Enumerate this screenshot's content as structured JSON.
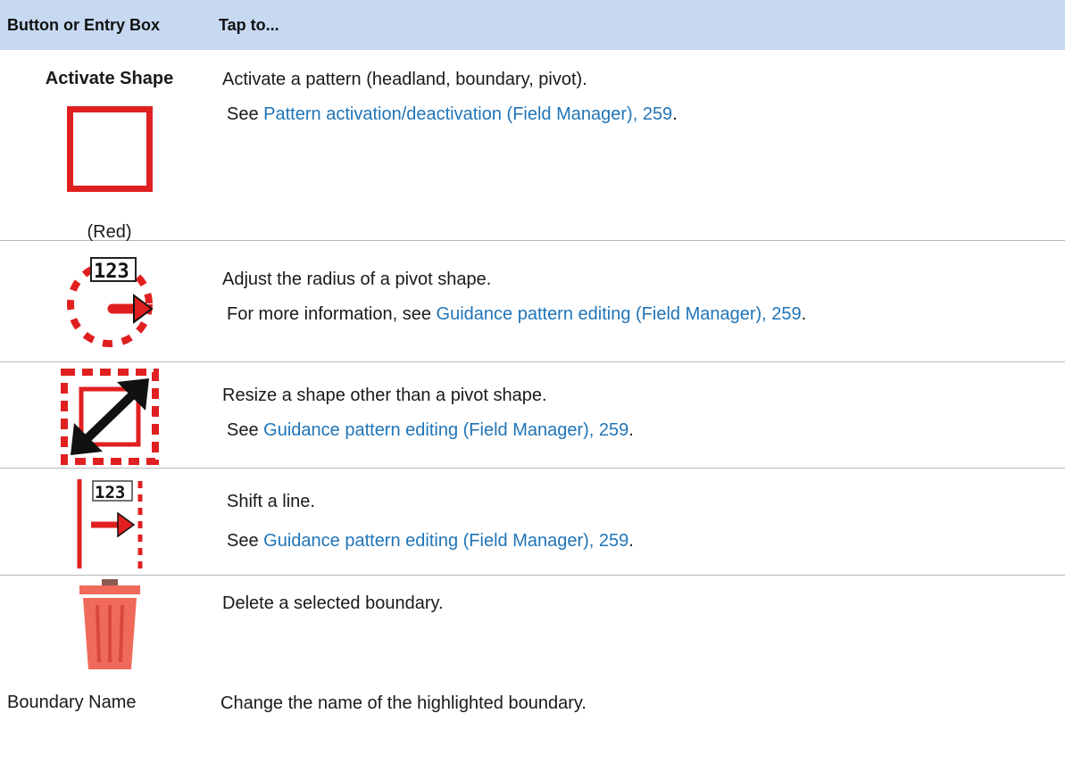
{
  "header": {
    "col1": "Button or Entry Box",
    "col2": "Tap to..."
  },
  "rows": [
    {
      "button_label": "Activate Shape",
      "icon": "red-square-outline-icon",
      "icon_caption": "(Red)",
      "line1": "Activate a pattern (headland, boundary, pivot).",
      "line2_prefix": "See ",
      "line2_link": "Pattern activation/deactivation (Field Manager), 259",
      "line2_suffix": "."
    },
    {
      "icon": "pivot-radius-icon",
      "icon_text": "123",
      "line1": "Adjust the radius of a pivot shape.",
      "line2_prefix": "For more information, see ",
      "line2_link": "Guidance pattern editing (Field Manager), 259",
      "line2_suffix": "."
    },
    {
      "icon": "resize-shape-icon",
      "line1": "Resize a shape other than a pivot shape.",
      "line2_prefix": "See ",
      "line2_link": "Guidance pattern editing (Field Manager), 259",
      "line2_suffix": "."
    },
    {
      "icon": "shift-line-icon",
      "icon_text": "123",
      "line1": "Shift a line.",
      "line2_prefix": "See ",
      "line2_link": "Guidance pattern editing (Field Manager), 259",
      "line2_suffix": "."
    },
    {
      "icon": "trash-icon",
      "line1": "Delete a selected boundary."
    },
    {
      "button_label": "Boundary Name",
      "line1": "Change the name of the highlighted boundary."
    }
  ],
  "colors": {
    "header_bg": "#c6d9f1",
    "link": "#1f74b8",
    "icon_red": "#e02020",
    "trash_red": "#ef6a5a"
  }
}
